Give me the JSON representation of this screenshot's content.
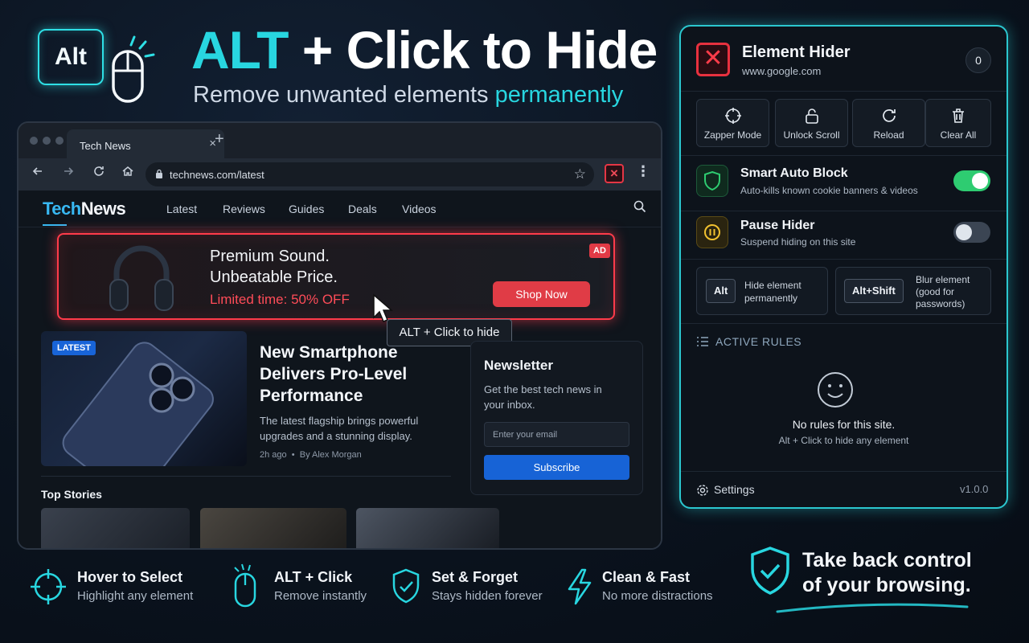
{
  "hero": {
    "alt_key": "Alt",
    "title_accent": "ALT",
    "title_rest": " + Click to Hide",
    "subtitle_main": "Remove unwanted elements ",
    "subtitle_accent": "permanently"
  },
  "browser": {
    "tab_title": "Tech News",
    "tab_close": "×",
    "new_tab": "+",
    "url": "technews.com/latest",
    "site": {
      "logo_tech": "Tech",
      "logo_news": "News",
      "nav": [
        "Latest",
        "Reviews",
        "Guides",
        "Deals",
        "Videos"
      ]
    },
    "ad": {
      "line1": "Premium Sound.",
      "line2": "Unbeatable Price.",
      "offer": "Limited time: 50% OFF",
      "button": "Shop Now",
      "badge": "AD"
    },
    "tooltip": "ALT + Click to hide",
    "article": {
      "badge": "LATEST",
      "title": "New Smartphone Delivers Pro-Level Performance",
      "desc": "The latest flagship brings powerful upgrades and a stunning display.",
      "time": "2h ago",
      "author": "By Alex Morgan"
    },
    "newsletter": {
      "title": "Newsletter",
      "desc": "Get the best tech news in your inbox.",
      "placeholder": "Enter your email",
      "button": "Subscribe"
    },
    "top_stories": "Top Stories"
  },
  "panel": {
    "title": "Element Hider",
    "domain": "www.google.com",
    "count": "0",
    "actions": [
      {
        "label": "Zapper Mode",
        "icon": "crosshair-icon"
      },
      {
        "label": "Unlock Scroll",
        "icon": "unlock-icon"
      },
      {
        "label": "Reload",
        "icon": "reload-icon"
      },
      {
        "label": "Clear All",
        "icon": "trash-icon"
      }
    ],
    "smart_block": {
      "title": "Smart Auto Block",
      "sub": "Auto-kills known cookie banners & videos",
      "on": true
    },
    "pause": {
      "title": "Pause Hider",
      "sub": "Suspend hiding on this site",
      "on": false
    },
    "shortcut1": {
      "key": "Alt",
      "line1": "Hide element",
      "line2": "permanently"
    },
    "shortcut2": {
      "key": "Alt+Shift",
      "line1": "Blur element",
      "line2": "(good for",
      "line3": "passwords)"
    },
    "rules_head": "ACTIVE RULES",
    "empty_title": "No rules for this site.",
    "empty_sub": "Alt + Click to hide any element",
    "settings": "Settings",
    "version": "v1.0.0"
  },
  "features": [
    {
      "title": "Hover to Select",
      "sub": "Highlight any element",
      "icon": "crosshair-icon"
    },
    {
      "title": "ALT + Click",
      "sub": "Remove instantly",
      "icon": "mouse-icon"
    },
    {
      "title": "Set & Forget",
      "sub": "Stays hidden forever",
      "icon": "shield-check-icon"
    },
    {
      "title": "Clean & Fast",
      "sub": "No more distractions",
      "icon": "lightning-icon"
    }
  ],
  "cta": {
    "line1": "Take back control",
    "line2": "of your browsing."
  },
  "colors": {
    "accent": "#28d6e0",
    "danger": "#ff3b4a",
    "primary_blue": "#1763d6",
    "toggle_on": "#2ecc71"
  }
}
